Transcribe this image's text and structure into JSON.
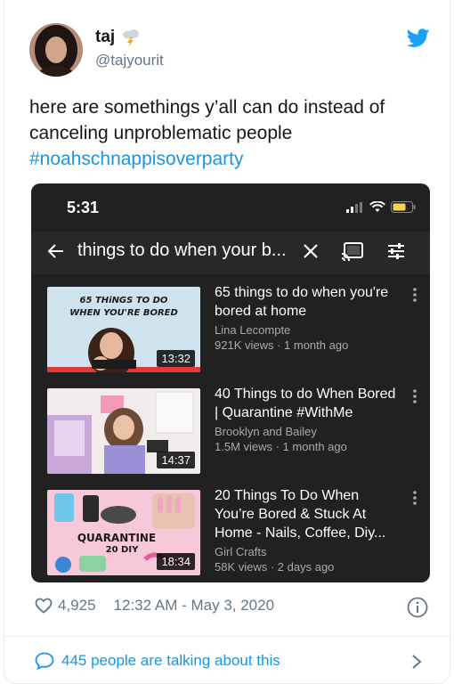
{
  "user": {
    "name": "taj",
    "handle": "@tajyourit"
  },
  "tweet": {
    "text": "here are somethings y’all can do instead of canceling unproblematic people",
    "hashtag": "#noahschnappisoverparty"
  },
  "phone": {
    "status_time": "5:31",
    "search_query": "things to do when your b...",
    "results": [
      {
        "title": "65 things to do when you're bored at home",
        "channel": "Lina Lecompte",
        "meta": "921K views · 1 month ago",
        "duration": "13:32",
        "thumb_text": "65 THiNGS TO DO WHEN YOU'RE BORED"
      },
      {
        "title": "40 Things to do When Bored | Quarantine #WithMe",
        "channel": "Brooklyn and Bailey",
        "meta": "1.5M views · 1 month ago",
        "duration": "14:37"
      },
      {
        "title": "20 Things To Do When You’re Bored & Stuck At Home - Nails, Coffee, Diy...",
        "channel": "Girl Crafts",
        "meta": "58K views · 2 days ago",
        "duration": "18:34",
        "thumb_text_1": "QUARANTINE",
        "thumb_text_2": "20 DIY"
      }
    ]
  },
  "footer": {
    "likes": "4,925",
    "timestamp": "12:32 AM - May 3, 2020",
    "talking": "445 people are talking about this"
  },
  "colors": {
    "twitter_blue": "#1b95e0",
    "muted": "#657786",
    "dark_bg": "#212121"
  }
}
